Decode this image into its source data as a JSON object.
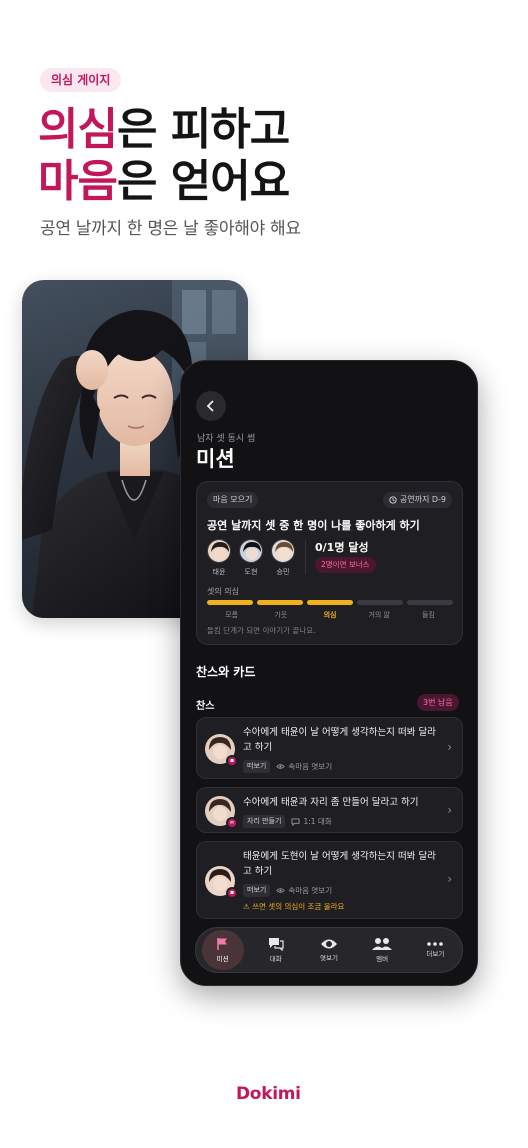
{
  "promo": {
    "tag": "의심 게이지",
    "headline_line1_accent": "의심",
    "headline_line1_rest": "은 피하고",
    "headline_line2_accent": "마음",
    "headline_line2_rest": "은 얻어요",
    "subtitle": "공연 날까지 한 명은 날 좋아해야 해요"
  },
  "screen": {
    "subtitle": "남자 셋 동시 썸",
    "title": "미션",
    "mission": {
      "chip": "마음 모으기",
      "dday": "공연까지 D-9",
      "title": "공연 날까지 셋 중 한 명이 나를 좋아하게 하기",
      "members": [
        "태윤",
        "도현",
        "승민"
      ],
      "progress": "0/1명 달성",
      "bonus": "2명이면 보너스",
      "gauge_label": "셋의 의심",
      "gauge_steps": [
        "모름",
        "가웃",
        "의심",
        "거의 앎",
        "들킴"
      ],
      "gauge_level": 3,
      "gauge_total": 5,
      "gauge_note": "들킴 단계가 되면 이야기가 끝나요."
    },
    "section_title": "찬스와 카드",
    "chance_label": "찬스",
    "remaining": "3번 남음",
    "items": [
      {
        "text": "수아에게 태윤이 날 어떻게 생각하는지 떠봐 달라고 하기",
        "chip": "떠보기",
        "sub": "속마음 엿보기"
      },
      {
        "text": "수아에게 태윤과 자리 좀 만들어 달라고 하기",
        "chip": "자리 만들기",
        "sub": "1:1 대화"
      },
      {
        "text": "태윤에게 도현이 날 어떻게 생각하는지 떠봐 달라고 하기",
        "chip": "떠보기",
        "sub": "속마음 엿보기",
        "warning": "⚠ 쓰면 셋의 의심이 조금 올라요"
      }
    ],
    "nav": [
      {
        "label": "미션",
        "icon": "flag-icon"
      },
      {
        "label": "대화",
        "icon": "chat-icon"
      },
      {
        "label": "엿보기",
        "icon": "eye-icon"
      },
      {
        "label": "멤버",
        "icon": "people-icon"
      },
      {
        "label": "더보기",
        "icon": "more-icon"
      }
    ]
  },
  "brand": {
    "logo": "Dokimi",
    "accent_color": "#c2185b",
    "gauge_color": "#f2b01e"
  }
}
